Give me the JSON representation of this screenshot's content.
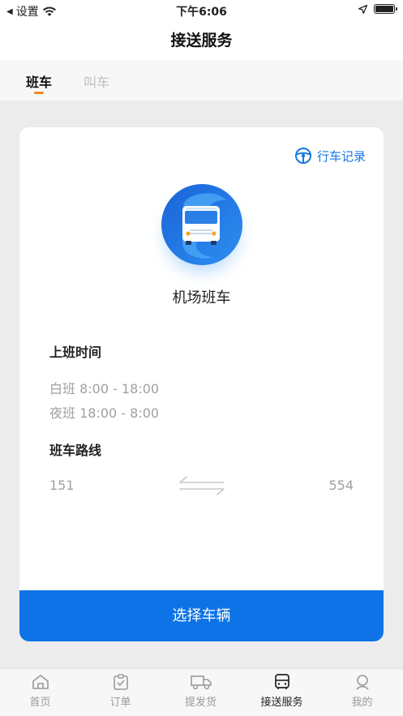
{
  "status_bar": {
    "back_label": "设置",
    "time": "下午6:06"
  },
  "header": {
    "title": "接送服务"
  },
  "tabs": [
    {
      "label": "班车",
      "active": true
    },
    {
      "label": "叫车",
      "active": false
    }
  ],
  "card": {
    "record_link": "行车记录",
    "shuttle_name": "机场班车",
    "schedule_label": "上班时间",
    "schedule": [
      "白班 8:00 - 18:00",
      "夜班 18:00 - 8:00"
    ],
    "route_label": "班车路线",
    "route_from": "151",
    "route_to": "554",
    "select_button": "选择车辆"
  },
  "tabbar": [
    {
      "label": "首页",
      "icon": "home-icon",
      "active": false
    },
    {
      "label": "订单",
      "icon": "order-icon",
      "active": false
    },
    {
      "label": "提发货",
      "icon": "truck-icon",
      "active": false
    },
    {
      "label": "接送服务",
      "icon": "bus-icon",
      "active": true
    },
    {
      "label": "我的",
      "icon": "profile-icon",
      "active": false
    }
  ],
  "colors": {
    "accent": "#0e73e6",
    "tab_indicator": "#f08a1c",
    "background": "#ececec"
  }
}
